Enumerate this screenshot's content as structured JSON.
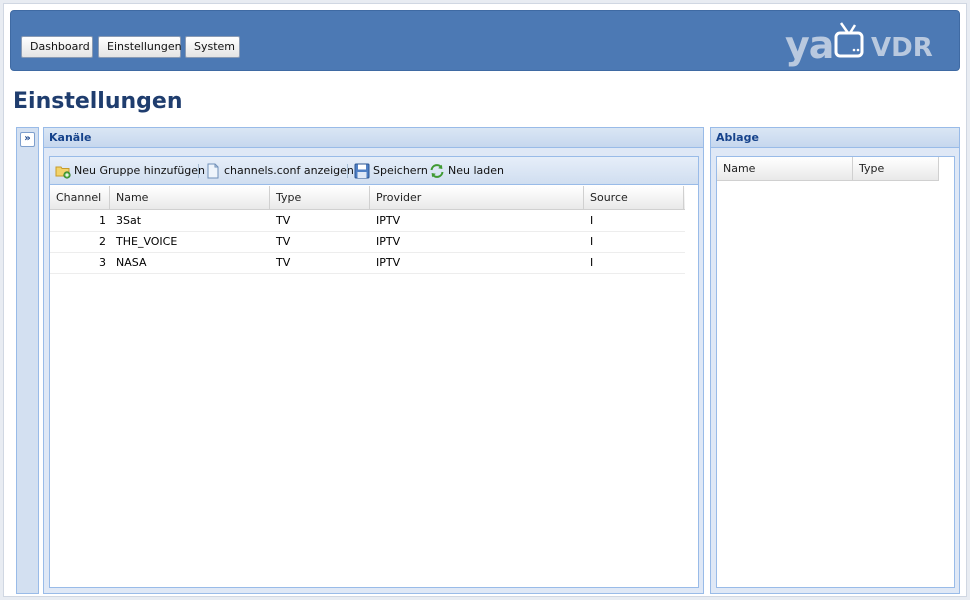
{
  "nav": {
    "items": [
      "Dashboard",
      "Einstellungen",
      "System"
    ]
  },
  "logo": {
    "part1": "ya",
    "part2": "VDR"
  },
  "page": {
    "title": "Einstellungen"
  },
  "channels_panel": {
    "title": "Kanäle",
    "toolbar": {
      "add_group": "Neu Gruppe hinzufügen",
      "show_conf": "channels.conf anzeigen",
      "save": "Speichern",
      "reload": "Neu laden"
    },
    "columns": [
      "Channel",
      "Name",
      "Type",
      "Provider",
      "Source"
    ],
    "rows": [
      {
        "channel": "1",
        "name": "3Sat",
        "type": "TV",
        "provider": "IPTV",
        "source": "I"
      },
      {
        "channel": "2",
        "name": "THE_VOICE",
        "type": "TV",
        "provider": "IPTV",
        "source": "I"
      },
      {
        "channel": "3",
        "name": "NASA",
        "type": "TV",
        "provider": "IPTV",
        "source": "I"
      }
    ]
  },
  "storage_panel": {
    "title": "Ablage",
    "columns": [
      "Name",
      "Type"
    ]
  },
  "icons": {
    "expand": "double-chevron-right-icon",
    "add_group": "folder-add-icon",
    "show_conf": "document-icon",
    "save": "floppy-disk-icon",
    "reload": "refresh-icon"
  },
  "colors": {
    "header_bg": "#4c79b4",
    "title": "#1f3d6e",
    "panel_title": "#15428b"
  }
}
